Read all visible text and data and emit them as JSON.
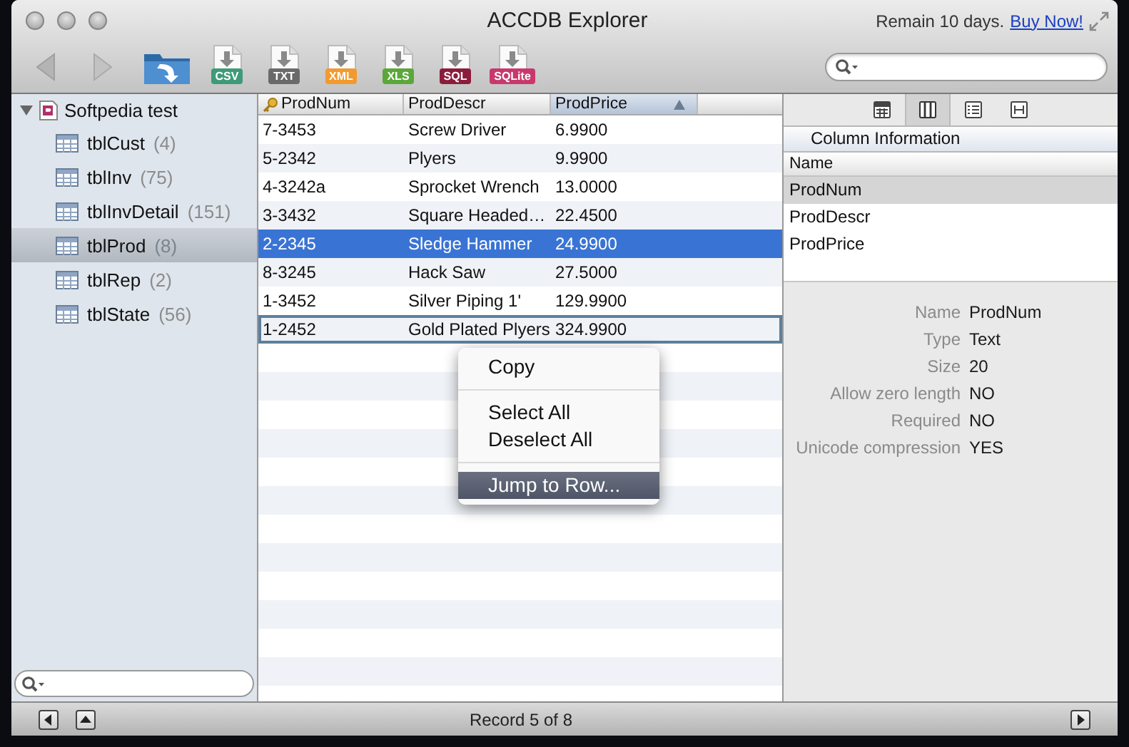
{
  "window": {
    "title": "ACCDB Explorer",
    "trial_notice": "Remain 10 days.",
    "buy_link": "Buy Now!"
  },
  "toolbar": {
    "exports": [
      {
        "label": "CSV",
        "color": "#3e9a78"
      },
      {
        "label": "TXT",
        "color": "#6a6a6a"
      },
      {
        "label": "XML",
        "color": "#f29a2e"
      },
      {
        "label": "XLS",
        "color": "#5aa83a"
      },
      {
        "label": "SQL",
        "color": "#8c1c3c"
      },
      {
        "label": "SQLite",
        "color": "#c8386c"
      }
    ]
  },
  "sidebar": {
    "database": {
      "name": "Softpedia test",
      "expanded": true,
      "children": [
        {
          "name": "tblCust",
          "count": "(4)",
          "selected": false
        },
        {
          "name": "tblInv",
          "count": "(75)",
          "selected": false
        },
        {
          "name": "tblInvDetail",
          "count": "(151)",
          "selected": false
        },
        {
          "name": "tblProd",
          "count": "(8)",
          "selected": true
        },
        {
          "name": "tblRep",
          "count": "(2)",
          "selected": false
        },
        {
          "name": "tblState",
          "count": "(56)",
          "selected": false
        }
      ]
    }
  },
  "table": {
    "columns": [
      {
        "label": "ProdNum",
        "key": true,
        "sorted": false
      },
      {
        "label": "ProdDescr",
        "key": false,
        "sorted": false
      },
      {
        "label": "ProdPrice",
        "key": false,
        "sorted": true
      }
    ],
    "rows": [
      {
        "cells": [
          "7-3453",
          "Screw Driver",
          "6.9900"
        ],
        "selected": false,
        "focused": false
      },
      {
        "cells": [
          "5-2342",
          "Plyers",
          "9.9900"
        ],
        "selected": false,
        "focused": false
      },
      {
        "cells": [
          "4-3242a",
          "Sprocket Wrench",
          "13.0000"
        ],
        "selected": false,
        "focused": false
      },
      {
        "cells": [
          "3-3432",
          "Square Headed…",
          "22.4500"
        ],
        "selected": false,
        "focused": false
      },
      {
        "cells": [
          "2-2345",
          "Sledge Hammer",
          "24.9900"
        ],
        "selected": true,
        "focused": false
      },
      {
        "cells": [
          "8-3245",
          "Hack Saw",
          "27.5000"
        ],
        "selected": false,
        "focused": false
      },
      {
        "cells": [
          "1-3452",
          "Silver Piping 1'",
          "129.9900"
        ],
        "selected": false,
        "focused": false
      },
      {
        "cells": [
          "1-2452",
          "Gold Plated Plyers",
          "324.9900"
        ],
        "selected": false,
        "focused": true
      }
    ]
  },
  "context_menu": {
    "items": [
      {
        "kind": "item",
        "label": "Copy",
        "highlighted": false
      },
      {
        "kind": "separator"
      },
      {
        "kind": "item",
        "label": "Select All",
        "highlighted": false
      },
      {
        "kind": "item",
        "label": "Deselect All",
        "highlighted": false
      },
      {
        "kind": "separator"
      },
      {
        "kind": "item",
        "label": "Jump to Row...",
        "highlighted": true
      }
    ]
  },
  "info_panel": {
    "view_buttons": [
      {
        "kind": "grid",
        "selected": false
      },
      {
        "kind": "columns",
        "selected": true
      },
      {
        "kind": "list",
        "selected": false
      },
      {
        "kind": "fit",
        "selected": false
      }
    ],
    "section_title": "Column Information",
    "list_header": "Name",
    "columns": [
      {
        "name": "ProdNum",
        "selected": true
      },
      {
        "name": "ProdDescr",
        "selected": false
      },
      {
        "name": "ProdPrice",
        "selected": false
      }
    ],
    "properties": [
      {
        "label": "Name",
        "value": "ProdNum"
      },
      {
        "label": "Type",
        "value": "Text"
      },
      {
        "label": "Size",
        "value": "20"
      },
      {
        "label": "Allow zero length",
        "value": "NO"
      },
      {
        "label": "Required",
        "value": "NO"
      },
      {
        "label": "Unicode compression",
        "value": "YES"
      }
    ]
  },
  "status_bar": {
    "left_buttons": [
      {
        "kind": "previous"
      },
      {
        "kind": "up"
      }
    ],
    "record": "Record 5 of 8",
    "right_buttons": [
      {
        "kind": "next"
      }
    ]
  }
}
